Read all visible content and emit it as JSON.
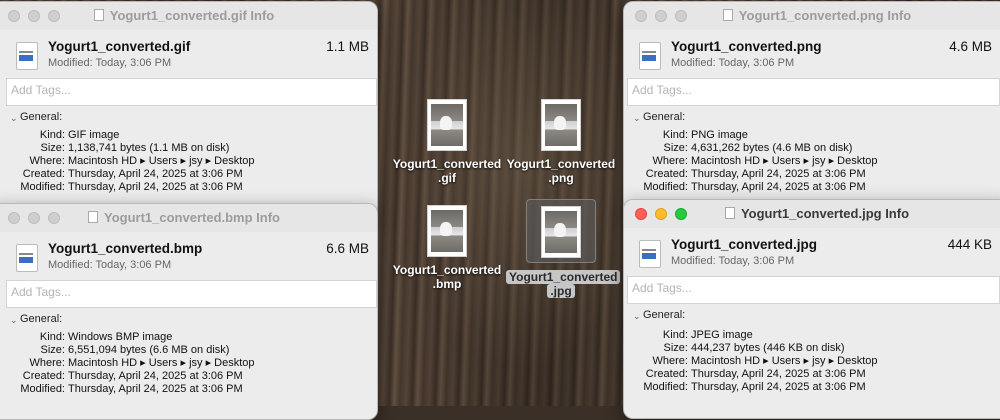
{
  "windows": {
    "gif": {
      "title": "Yogurt1_converted.gif Info",
      "filename": "Yogurt1_converted.gif",
      "size": "1.1 MB",
      "modified_line": "Modified: Today, 3:06 PM",
      "tags_placeholder": "Add Tags...",
      "section": "General:",
      "rows": [
        {
          "k": "Kind:",
          "v": "GIF image"
        },
        {
          "k": "Size:",
          "v": "1,138,741 bytes (1.1 MB on disk)"
        },
        {
          "k": "Where:",
          "v": "Macintosh HD ▸ Users ▸ jsy ▸ Desktop"
        },
        {
          "k": "Created:",
          "v": "Thursday, April 24, 2025 at 3:06 PM"
        },
        {
          "k": "Modified:",
          "v": "Thursday, April 24, 2025 at 3:06 PM"
        }
      ]
    },
    "bmp": {
      "title": "Yogurt1_converted.bmp Info",
      "filename": "Yogurt1_converted.bmp",
      "size": "6.6 MB",
      "modified_line": "Modified: Today, 3:06 PM",
      "tags_placeholder": "Add Tags...",
      "section": "General:",
      "rows": [
        {
          "k": "Kind:",
          "v": "Windows BMP image"
        },
        {
          "k": "Size:",
          "v": "6,551,094 bytes (6.6 MB on disk)"
        },
        {
          "k": "Where:",
          "v": "Macintosh HD ▸ Users ▸ jsy ▸ Desktop"
        },
        {
          "k": "Created:",
          "v": "Thursday, April 24, 2025 at 3:06 PM"
        },
        {
          "k": "Modified:",
          "v": "Thursday, April 24, 2025 at 3:06 PM"
        }
      ]
    },
    "png": {
      "title": "Yogurt1_converted.png Info",
      "filename": "Yogurt1_converted.png",
      "size": "4.6 MB",
      "modified_line": "Modified: Today, 3:06 PM",
      "tags_placeholder": "Add Tags...",
      "section": "General:",
      "rows": [
        {
          "k": "Kind:",
          "v": "PNG image"
        },
        {
          "k": "Size:",
          "v": "4,631,262 bytes (4.6 MB on disk)"
        },
        {
          "k": "Where:",
          "v": "Macintosh HD ▸ Users ▸ jsy ▸ Desktop"
        },
        {
          "k": "Created:",
          "v": "Thursday, April 24, 2025 at 3:06 PM"
        },
        {
          "k": "Modified:",
          "v": "Thursday, April 24, 2025 at 3:06 PM"
        }
      ]
    },
    "jpg": {
      "title": "Yogurt1_converted.jpg Info",
      "filename": "Yogurt1_converted.jpg",
      "size": "444 KB",
      "modified_line": "Modified: Today, 3:06 PM",
      "tags_placeholder": "Add Tags...",
      "section": "General:",
      "rows": [
        {
          "k": "Kind:",
          "v": "JPEG image"
        },
        {
          "k": "Size:",
          "v": "444,237 bytes (446 KB on disk)"
        },
        {
          "k": "Where:",
          "v": "Macintosh HD ▸ Users ▸ jsy ▸ Desktop"
        },
        {
          "k": "Created:",
          "v": "Thursday, April 24, 2025 at 3:06 PM"
        },
        {
          "k": "Modified:",
          "v": "Thursday, April 24, 2025 at 3:06 PM"
        }
      ]
    }
  },
  "desktop_icons": [
    {
      "line1": "Yogurt1_converted",
      "line2": ".gif",
      "selected": false
    },
    {
      "line1": "Yogurt1_converted",
      "line2": ".png",
      "selected": false
    },
    {
      "line1": "Yogurt1_converted",
      "line2": ".bmp",
      "selected": false
    },
    {
      "line1": "Yogurt1_converted",
      "line2": ".jpg",
      "selected": true
    }
  ],
  "colors": {
    "close": "#fe5f57",
    "minimize": "#febc2e",
    "zoom": "#28c840"
  }
}
